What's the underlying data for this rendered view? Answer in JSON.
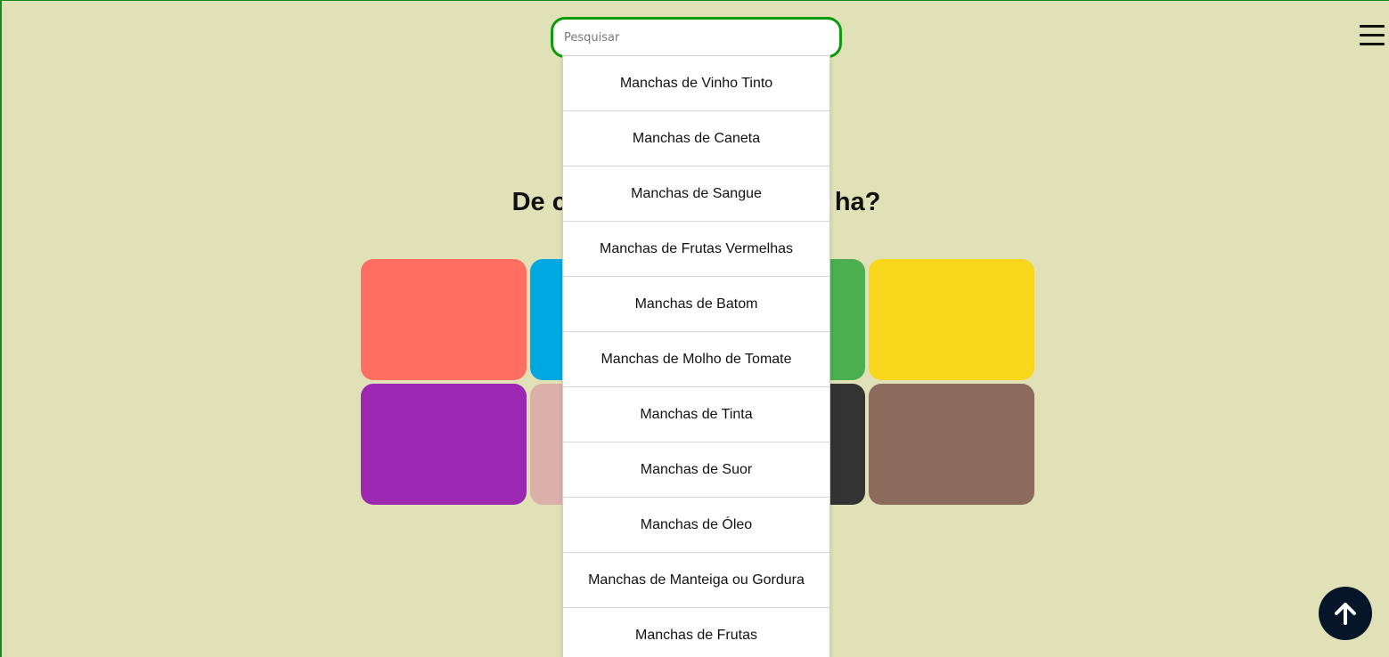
{
  "search": {
    "placeholder": "Pesquisar",
    "value": ""
  },
  "menu": {
    "icon": "hamburger-menu-icon"
  },
  "heading": {
    "title_left": "De c",
    "title_right": "ha?"
  },
  "tiles": [
    {
      "name": "red",
      "color": "#ff6f61"
    },
    {
      "name": "blue",
      "color": "#00a8e1"
    },
    {
      "name": "green",
      "color": "#4caf50"
    },
    {
      "name": "yellow",
      "color": "#f9d71c"
    },
    {
      "name": "purple",
      "color": "#9c27b0"
    },
    {
      "name": "pink",
      "color": "#dbb0a8"
    },
    {
      "name": "black",
      "color": "#333333"
    },
    {
      "name": "brown",
      "color": "#8d6b5c"
    }
  ],
  "suggestions": [
    "Manchas de Vinho Tinto",
    "Manchas de Caneta",
    "Manchas de Sangue",
    "Manchas de Frutas Vermelhas",
    "Manchas de Batom",
    "Manchas de Molho de Tomate",
    "Manchas de Tinta",
    "Manchas de Suor",
    "Manchas de Óleo",
    "Manchas de Manteiga ou Gordura",
    "Manchas de Frutas"
  ],
  "back_to_top": {
    "icon": "arrow-up-icon"
  },
  "colors": {
    "background": "#e1e1b8",
    "accent": "#0a9a0a",
    "button": "#061528"
  }
}
